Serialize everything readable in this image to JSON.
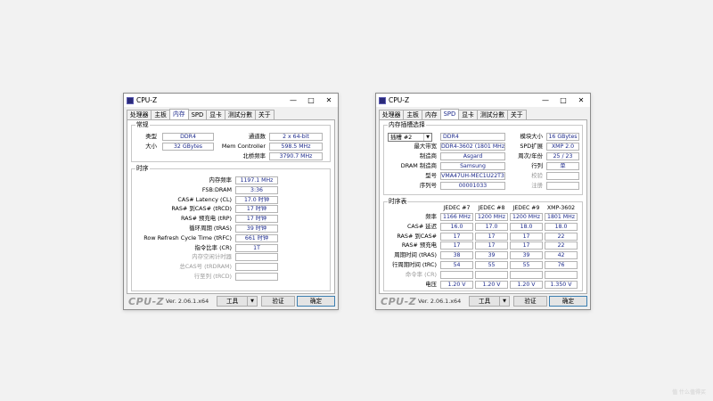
{
  "win1": {
    "title": "CPU-Z",
    "tabs": [
      "处理器",
      "主板",
      "内存",
      "SPD",
      "显卡",
      "测試分數",
      "关于"
    ],
    "general": {
      "label": "常规",
      "type_label": "类型",
      "type_value": "DDR4",
      "size_label": "大小",
      "size_value": "32 GBytes",
      "channels_label": "通道数",
      "channels_value": "2 x 64-bit",
      "memctrl_label": "Mem Controller",
      "memctrl_value": "598.5 MHz",
      "nb_label": "北桥频率",
      "nb_value": "3790.7 MHz"
    },
    "timings": {
      "label": "时序",
      "rows": [
        {
          "label": "内存频率",
          "value": "1197.1 MHz"
        },
        {
          "label": "FSB:DRAM",
          "value": "3:36"
        },
        {
          "label": "CAS# Latency (CL)",
          "value": "17.0 时钟"
        },
        {
          "label": "RAS# 到CAS# (tRCD)",
          "value": "17 时钟"
        },
        {
          "label": "RAS# 预充电 (tRP)",
          "value": "17 时钟"
        },
        {
          "label": "循环周期 (tRAS)",
          "value": "39 时钟"
        },
        {
          "label": "Row Refresh Cycle Time (tRFC)",
          "value": "661 时钟"
        },
        {
          "label": "指令比率 (CR)",
          "value": "1T"
        },
        {
          "label": "内存空闲计时器",
          "value": ""
        },
        {
          "label": "总CAS号 (tRDRAM)",
          "value": ""
        },
        {
          "label": "行至列 (tRCD)",
          "value": ""
        }
      ]
    },
    "footer": {
      "logo": "CPU-Z",
      "version": "Ver. 2.06.1.x64",
      "tools": "工具",
      "validate": "验证",
      "ok": "确定"
    }
  },
  "win2": {
    "title": "CPU-Z",
    "tabs": [
      "处理器",
      "主板",
      "内存",
      "SPD",
      "显卡",
      "测試分數",
      "关于"
    ],
    "slot": {
      "label": "内存插槽选择",
      "selected": "插槽 #2",
      "type_value": "DDR4",
      "module_size_label": "模块大小",
      "module_size_value": "16 GBytes",
      "maxbw_label": "最大带宽",
      "maxbw_value": "DDR4-3602 (1801 MHz)",
      "spdext_label": "SPD扩展",
      "spdext_value": "XMP 2.0",
      "mfr_label": "制造商",
      "mfr_value": "Asgard",
      "weekyear_label": "周次/年份",
      "weekyear_value": "25 / 23",
      "dram_label": "DRAM 制造商",
      "dram_value": "Samsung",
      "rank_label": "行列",
      "rank_value": "单",
      "part_label": "型号",
      "part_value": "VMA47UH-MEC1U22T3",
      "correction_label": "校验",
      "correction_value": "",
      "serial_label": "序列号",
      "serial_value": "00001033",
      "registered_label": "注册",
      "registered_value": ""
    },
    "timings": {
      "label": "时序表",
      "headers": [
        "JEDEC #7",
        "JEDEC #8",
        "JEDEC #9",
        "XMP-3602"
      ],
      "rows": [
        {
          "label": "频率",
          "values": [
            "1166 MHz",
            "1200 MHz",
            "1200 MHz",
            "1801 MHz"
          ]
        },
        {
          "label": "CAS# 延迟",
          "values": [
            "16.0",
            "17.0",
            "18.0",
            "18.0"
          ]
        },
        {
          "label": "RAS# 到CAS#",
          "values": [
            "17",
            "17",
            "17",
            "22"
          ]
        },
        {
          "label": "RAS# 预充电",
          "values": [
            "17",
            "17",
            "17",
            "22"
          ]
        },
        {
          "label": "周期时间 (tRAS)",
          "values": [
            "38",
            "39",
            "39",
            "42"
          ]
        },
        {
          "label": "行周期时间 (tRC)",
          "values": [
            "54",
            "55",
            "55",
            "76"
          ]
        },
        {
          "label": "命令率 (CR)",
          "values": [
            "",
            "",
            "",
            ""
          ]
        },
        {
          "label": "电压",
          "values": [
            "1.20 V",
            "1.20 V",
            "1.20 V",
            "1.350 V"
          ]
        }
      ]
    },
    "footer": {
      "logo": "CPU-Z",
      "version": "Ver. 2.06.1.x64",
      "tools": "工具",
      "validate": "验证",
      "ok": "确定"
    }
  },
  "watermark": "值 什么值得买"
}
